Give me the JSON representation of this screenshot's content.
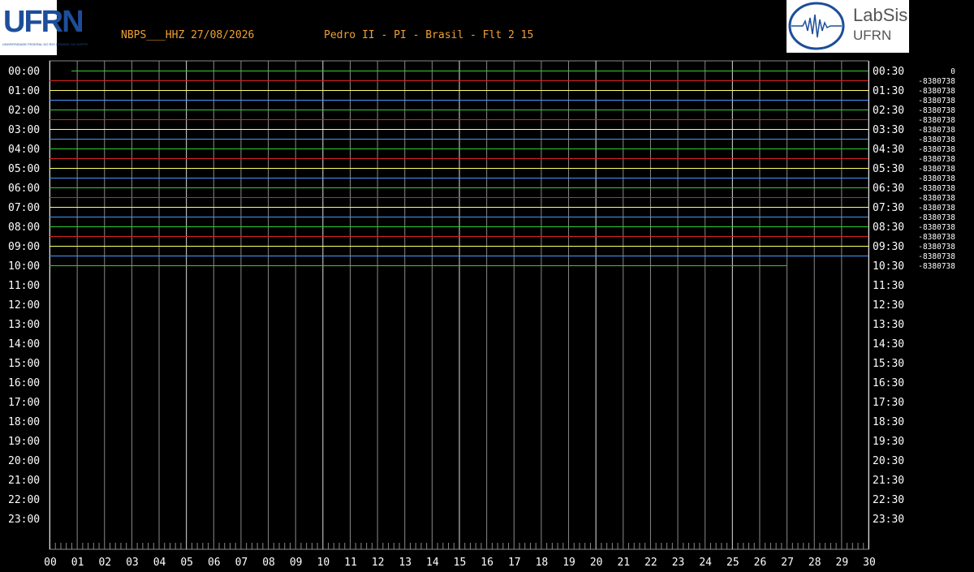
{
  "header": {
    "station": "NBPS___HHZ 27/08/2026",
    "location": "Pedro II - PI - Brasil - Flt 2 15",
    "title_color": "#f0a030"
  },
  "logos": {
    "left_text": "UFRN",
    "left_subtext": "UNIVERSIDADE FEDERAL DO RIO GRANDE DO NORTE",
    "right_text": "LabSis",
    "right_subtext": "UFRN"
  },
  "chart_data": {
    "type": "line",
    "x_ticks": [
      "00",
      "01",
      "02",
      "03",
      "04",
      "05",
      "06",
      "07",
      "08",
      "09",
      "10",
      "11",
      "12",
      "13",
      "14",
      "15",
      "16",
      "17",
      "18",
      "19",
      "20",
      "21",
      "22",
      "23",
      "24",
      "25",
      "26",
      "27",
      "28",
      "29",
      "30"
    ],
    "xlim": [
      0,
      30
    ],
    "left_labels": [
      "00:00",
      "01:00",
      "02:00",
      "03:00",
      "04:00",
      "05:00",
      "06:00",
      "07:00",
      "08:00",
      "09:00",
      "10:00",
      "11:00",
      "12:00",
      "13:00",
      "14:00",
      "15:00",
      "16:00",
      "17:00",
      "18:00",
      "19:00",
      "20:00",
      "21:00",
      "22:00",
      "23:00"
    ],
    "right_labels": [
      "00:30",
      "01:30",
      "02:30",
      "03:30",
      "04:30",
      "05:30",
      "06:30",
      "07:30",
      "08:30",
      "09:30",
      "10:30",
      "11:30",
      "12:30",
      "13:30",
      "14:30",
      "15:30",
      "16:30",
      "17:30",
      "18:30",
      "19:30",
      "20:30",
      "21:30",
      "22:30",
      "23:30"
    ],
    "offsets": [
      "0",
      "-8380738",
      "-8380738",
      "-8380738",
      "-8380738",
      "-8380738",
      "-8380738",
      "-8380738",
      "-8380738",
      "-8380738",
      "-8380738",
      "-8380738",
      "-8380738",
      "-8380738",
      "-8380738",
      "-8380738",
      "-8380738",
      "-8380738",
      "-8380738",
      "-8380738",
      "-8380738"
    ],
    "trace_colors": [
      "#33cc33",
      "#dd2222",
      "#ffff66",
      "#4499ff"
    ],
    "traces": [
      {
        "start": 0.8,
        "end": 30
      },
      {
        "start": 0,
        "end": 30
      },
      {
        "start": 0,
        "end": 30
      },
      {
        "start": 0,
        "end": 30
      },
      {
        "start": 0,
        "end": 30
      },
      {
        "start": 0,
        "end": 30
      },
      {
        "start": 0,
        "end": 30
      },
      {
        "start": 0,
        "end": 30
      },
      {
        "start": 0,
        "end": 30
      },
      {
        "start": 0,
        "end": 30
      },
      {
        "start": 0,
        "end": 30
      },
      {
        "start": 0,
        "end": 30
      },
      {
        "start": 0,
        "end": 30
      },
      {
        "start": 0,
        "end": 30
      },
      {
        "start": 0,
        "end": 30
      },
      {
        "start": 0,
        "end": 30
      },
      {
        "start": 0,
        "end": 30
      },
      {
        "start": 0,
        "end": 30
      },
      {
        "start": 0,
        "end": 30
      },
      {
        "start": 0,
        "end": 30
      },
      {
        "start": 0,
        "end": 27
      }
    ],
    "grid": true,
    "grid_color": "#888888",
    "label_color": "#ffffff"
  }
}
